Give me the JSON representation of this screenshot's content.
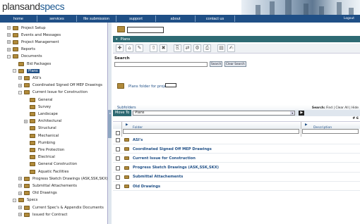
{
  "brand": {
    "plain": "plansand",
    "accent": "specs"
  },
  "nav": {
    "items": [
      "home",
      "services",
      "file submission",
      "support",
      "about",
      "contact us"
    ],
    "logout": "Logout"
  },
  "tree": [
    {
      "label": "Project Setup",
      "toggle": "+",
      "depth": 0
    },
    {
      "label": "Events and Messages",
      "toggle": "+",
      "depth": 0
    },
    {
      "label": "Project Management",
      "toggle": "+",
      "depth": 0
    },
    {
      "label": "Reports",
      "toggle": "+",
      "depth": 0
    },
    {
      "label": "Documents",
      "toggle": "-",
      "depth": 0
    },
    {
      "label": "Bid Packages",
      "toggle": "",
      "depth": 1
    },
    {
      "label": "Plans",
      "toggle": "-",
      "depth": 1,
      "selected": true
    },
    {
      "label": "ASI's",
      "toggle": "+",
      "depth": 2
    },
    {
      "label": "Coordinated Signed Off MEP Drawings",
      "toggle": "+",
      "depth": 2
    },
    {
      "label": "Current Issue for Construction",
      "toggle": "-",
      "depth": 2
    },
    {
      "label": "General",
      "toggle": "",
      "depth": 3
    },
    {
      "label": "Survey",
      "toggle": "",
      "depth": 3
    },
    {
      "label": "Landscape",
      "toggle": "",
      "depth": 3
    },
    {
      "label": "Architectural",
      "toggle": "+",
      "depth": 3
    },
    {
      "label": "Structural",
      "toggle": "",
      "depth": 3
    },
    {
      "label": "Mechanical",
      "toggle": "",
      "depth": 3
    },
    {
      "label": "Plumbing",
      "toggle": "",
      "depth": 3
    },
    {
      "label": "Fire Protection",
      "toggle": "",
      "depth": 3
    },
    {
      "label": "Electrical",
      "toggle": "",
      "depth": 3
    },
    {
      "label": "General Construction",
      "toggle": "",
      "depth": 3
    },
    {
      "label": "Aquatic Facilities",
      "toggle": "",
      "depth": 3
    },
    {
      "label": "Progress Sketch Drawings (ASK,SSK,SKX)",
      "toggle": "+",
      "depth": 2
    },
    {
      "label": "Submittal Attachements",
      "toggle": "+",
      "depth": 2
    },
    {
      "label": "Old Drawings",
      "toggle": "+",
      "depth": 2
    },
    {
      "label": "Specs",
      "toggle": "-",
      "depth": 1
    },
    {
      "label": "Current Spec's & Appendix Documents",
      "toggle": "+",
      "depth": 2
    },
    {
      "label": "Issued for Contract",
      "toggle": "+",
      "depth": 2
    }
  ],
  "panel": {
    "title": "Plans",
    "search_label": "Search",
    "search_button": "Search",
    "clear_button": "Clear Search",
    "plans_folder_label": "Plans folder for project",
    "subfolders_tab": "Subfolders",
    "search_actions": {
      "label": "Search:",
      "find": "Find",
      "clear": "Clear All",
      "hide": "Hide"
    },
    "move_to_label": "Move To",
    "move_to_value": "Plans",
    "go": "▶",
    "count": "# 6",
    "col_folder": "Folder",
    "col_description": "Description",
    "rows": [
      "ASI's",
      "Coordinated Signed Off MEP Drawings",
      "Current Issue for Construction",
      "Progress Sketch Drawings (ASK,SSK,SKX)",
      "Submittal Attachements",
      "Old Drawings"
    ]
  },
  "toolbar_icons": [
    "new-folder-icon",
    "home-icon",
    "edit-icon",
    "upload-icon",
    "delete-icon",
    "copy-icon",
    "move-icon",
    "settings-icon",
    "print-icon",
    "zip-icon",
    "note-icon"
  ],
  "colors": {
    "nav": "#1f4f86",
    "panel_bar": "#2e6a73",
    "folder": "#b08a3a"
  }
}
